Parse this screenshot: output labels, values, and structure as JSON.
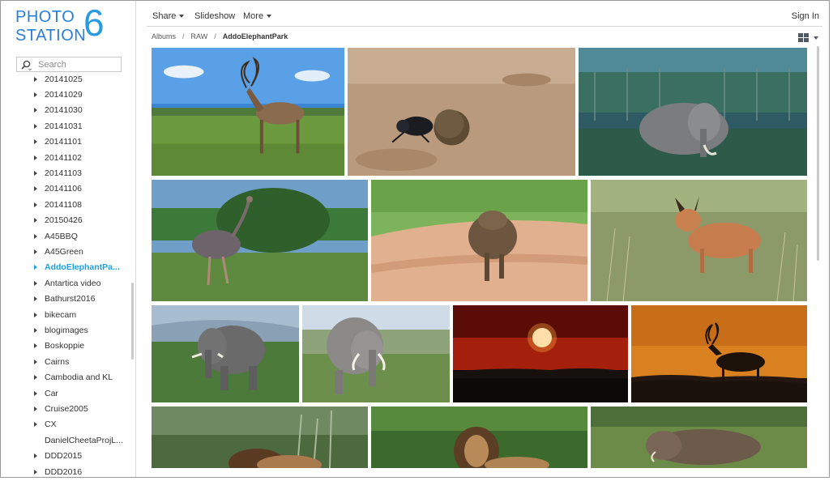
{
  "app": {
    "logo_line1": "PHOTO",
    "logo_line2": "STATION",
    "logo_version": "6"
  },
  "sidebar": {
    "search_placeholder": "Search",
    "items": [
      {
        "label": "20141025",
        "has_children": true,
        "active": false
      },
      {
        "label": "20141029",
        "has_children": true,
        "active": false
      },
      {
        "label": "20141030",
        "has_children": true,
        "active": false
      },
      {
        "label": "20141031",
        "has_children": true,
        "active": false
      },
      {
        "label": "20141101",
        "has_children": true,
        "active": false
      },
      {
        "label": "20141102",
        "has_children": true,
        "active": false
      },
      {
        "label": "20141103",
        "has_children": true,
        "active": false
      },
      {
        "label": "20141106",
        "has_children": true,
        "active": false
      },
      {
        "label": "20141108",
        "has_children": true,
        "active": false
      },
      {
        "label": "20150426",
        "has_children": true,
        "active": false
      },
      {
        "label": "A45BBQ",
        "has_children": true,
        "active": false
      },
      {
        "label": "A45Green",
        "has_children": true,
        "active": false
      },
      {
        "label": "AddoElephantPa...",
        "has_children": true,
        "active": true
      },
      {
        "label": "Antartica video",
        "has_children": true,
        "active": false
      },
      {
        "label": "Bathurst2016",
        "has_children": true,
        "active": false
      },
      {
        "label": "bikecam",
        "has_children": true,
        "active": false
      },
      {
        "label": "blogimages",
        "has_children": true,
        "active": false
      },
      {
        "label": "Boskoppie",
        "has_children": true,
        "active": false
      },
      {
        "label": "Cairns",
        "has_children": true,
        "active": false
      },
      {
        "label": "Cambodia and KL",
        "has_children": true,
        "active": false
      },
      {
        "label": "Car",
        "has_children": true,
        "active": false
      },
      {
        "label": "Cruise2005",
        "has_children": true,
        "active": false
      },
      {
        "label": "CX",
        "has_children": true,
        "active": false
      },
      {
        "label": "DanielCheetaProjL...",
        "has_children": false,
        "active": false
      },
      {
        "label": "DDD2015",
        "has_children": true,
        "active": false
      },
      {
        "label": "DDD2016",
        "has_children": true,
        "active": false
      }
    ]
  },
  "toolbar": {
    "share_label": "Share",
    "slideshow_label": "Slideshow",
    "more_label": "More",
    "signin_label": "Sign In"
  },
  "breadcrumb": {
    "items": [
      "Albums",
      "RAW",
      "AddoElephantPark"
    ],
    "separator": "/"
  },
  "photos": [
    {
      "subject": "kudu"
    },
    {
      "subject": "dung-beetle"
    },
    {
      "subject": "elephant-forest"
    },
    {
      "subject": "ostrich"
    },
    {
      "subject": "warthog-running"
    },
    {
      "subject": "caracal"
    },
    {
      "subject": "elephant-hill"
    },
    {
      "subject": "elephant-tusks"
    },
    {
      "subject": "sunset"
    },
    {
      "subject": "kudu-silhouette"
    },
    {
      "subject": "lion-reeds"
    },
    {
      "subject": "lion-bush"
    },
    {
      "subject": "warthog-lying"
    }
  ],
  "colors": {
    "accent": "#19a0e6",
    "logo": "#2a7fd4"
  }
}
